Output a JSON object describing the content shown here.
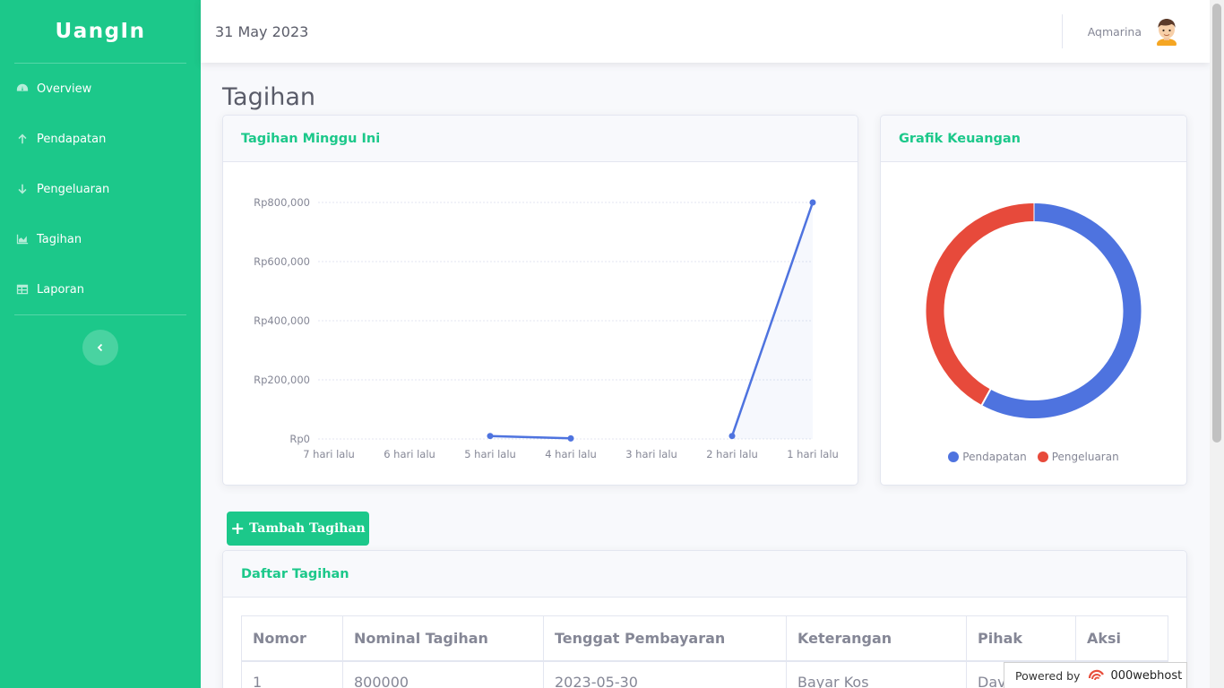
{
  "sidebar": {
    "brand": "UangIn",
    "items": [
      {
        "label": "Overview",
        "icon": "gauge-icon"
      },
      {
        "label": "Pendapatan",
        "icon": "arrow-up-icon"
      },
      {
        "label": "Pengeluaran",
        "icon": "arrow-down-icon"
      },
      {
        "label": "Tagihan",
        "icon": "area-chart-icon"
      },
      {
        "label": "Laporan",
        "icon": "table-icon"
      }
    ]
  },
  "topbar": {
    "date": "31 May 2023",
    "username": "Aqmarina"
  },
  "page": {
    "title": "Tagihan"
  },
  "cards": {
    "line_title": "Tagihan Minggu Ini",
    "pie_title": "Grafik Keuangan",
    "table_title": "Daftar Tagihan"
  },
  "add_button": {
    "label": "Tambah Tagihan"
  },
  "colors": {
    "accent": "#1cc88a",
    "line": "#4e73df",
    "income": "#4e73df",
    "expense": "#e74a3b"
  },
  "chart_data": [
    {
      "type": "line",
      "categories": [
        "7 hari lalu",
        "6 hari lalu",
        "5 hari lalu",
        "4 hari lalu",
        "3 hari lalu",
        "2 hari lalu",
        "1 hari lalu"
      ],
      "values": [
        null,
        null,
        10000,
        2000,
        null,
        10000,
        800000
      ],
      "y_ticks": [
        "Rp0",
        "Rp200,000",
        "Rp400,000",
        "Rp600,000",
        "Rp800,000"
      ],
      "ylim": [
        0,
        800000
      ],
      "grid": true
    },
    {
      "type": "pie",
      "style": "doughnut",
      "labels": [
        "Pendapatan",
        "Pengeluaran"
      ],
      "values": [
        58,
        42
      ],
      "legend": "bottom"
    }
  ],
  "table": {
    "headers": [
      "Nomor",
      "Nominal Tagihan",
      "Tenggat Pembayaran",
      "Keterangan",
      "Pihak",
      "Aksi"
    ],
    "rows": [
      [
        "1",
        "800000",
        "2023-05-30",
        "Bayar Kos",
        "David",
        ""
      ]
    ]
  },
  "footer": {
    "powered_by": "Powered by",
    "host": "000webhost"
  }
}
